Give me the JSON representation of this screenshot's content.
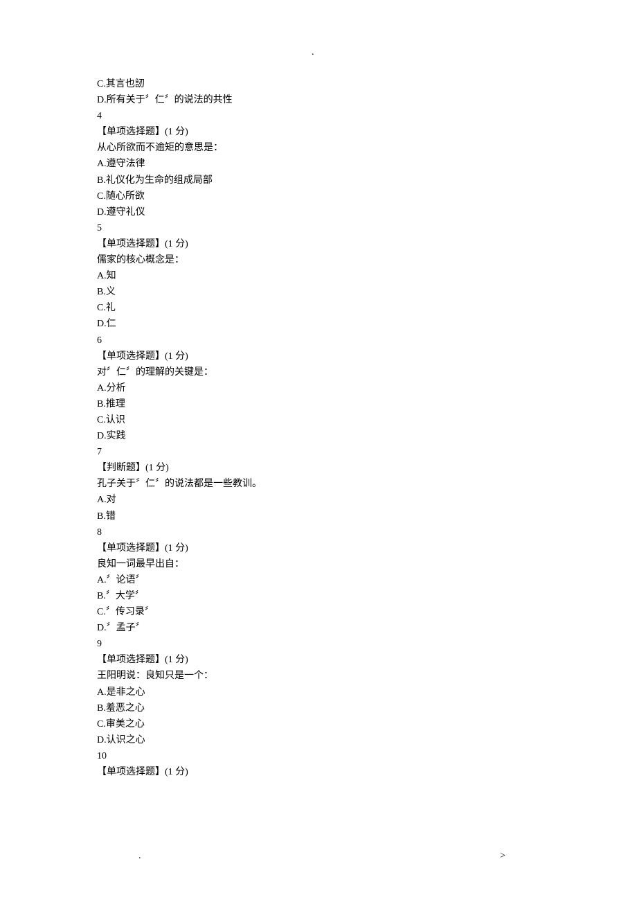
{
  "top_dot": ".",
  "bottom_left_dot": ".",
  "bottom_right_dot": ">",
  "q3_partial": {
    "optC": "C.其言也訒",
    "optD": "D.所有关于〞仁〞的说法的共性"
  },
  "q4": {
    "number": "4",
    "type": "【单项选择题】(1 分)",
    "stem": "从心所欲而不逾矩的意思是：",
    "optA": "A.遵守法律",
    "optB": "B.礼仪化为生命的组成局部",
    "optC": "C.随心所欲",
    "optD": "D.遵守礼仪"
  },
  "q5": {
    "number": "5",
    "type": "【单项选择题】(1 分)",
    "stem": "儒家的核心概念是：",
    "optA": "A.知",
    "optB": "B.义",
    "optC": "C.礼",
    "optD": "D.仁"
  },
  "q6": {
    "number": "6",
    "type": "【单项选择题】(1 分)",
    "stem": "对〞仁〞的理解的关键是：",
    "optA": "A.分析",
    "optB": "B.推理",
    "optC": "C.认识",
    "optD": "D.实践"
  },
  "q7": {
    "number": "7",
    "type": "【判断题】(1 分)",
    "stem": "孔子关于〞仁〞的说法都是一些教训。",
    "optA": "A.对",
    "optB": "B.错"
  },
  "q8": {
    "number": "8",
    "type": "【单项选择题】(1 分)",
    "stem": "良知一词最早出自：",
    "optA": "A.〞论语〞",
    "optB": "B.〞大学〞",
    "optC": "C.〞传习录〞",
    "optD": "D.〞孟子〞"
  },
  "q9": {
    "number": "9",
    "type": "【单项选择题】(1 分)",
    "stem": "王阳明说：良知只是一个：",
    "optA": "A.是非之心",
    "optB": "B.羞恶之心",
    "optC": "C.审美之心",
    "optD": "D.认识之心"
  },
  "q10": {
    "number": "10",
    "type": "【单项选择题】(1 分)"
  }
}
